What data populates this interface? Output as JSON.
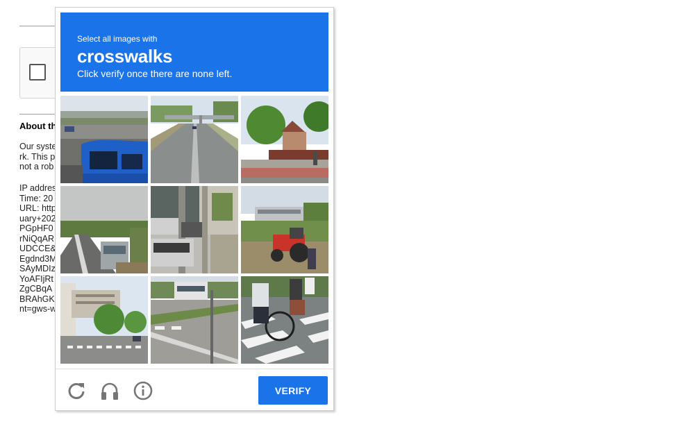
{
  "background_page": {
    "about_heading": "About th",
    "paragraph1": [
      "Our syste",
      "rk. This p",
      "not a rob"
    ],
    "paragraph2": [
      "IP addres",
      "Time: 20",
      "URL: http",
      "uary+202",
      "PGpHF0",
      "rNiQqAR",
      "UDCCE&",
      "Egdnd3M",
      "SAyMDIz",
      "YoAFIjRt",
      "ZgCBqA",
      "BRAhGK",
      "nt=gws-w"
    ]
  },
  "challenge": {
    "instruction_small": "Select all images with",
    "target_word": "crosswalks",
    "instruction_sub": "Click verify once there are none left.",
    "tiles": [
      {
        "icon": "highway-overpass-blue-car-image"
      },
      {
        "icon": "highway-overpass-road-image"
      },
      {
        "icon": "house-trees-sidewalk-image"
      },
      {
        "icon": "rural-road-bus-image"
      },
      {
        "icon": "parked-cars-building-image"
      },
      {
        "icon": "red-tractor-field-image"
      },
      {
        "icon": "city-street-crosswalk-image"
      },
      {
        "icon": "street-bus-crosswalk-image"
      },
      {
        "icon": "cyclist-pedestrian-crosswalk-image"
      }
    ],
    "footer": {
      "reload_icon": "reload-icon",
      "audio_icon": "headphones-icon",
      "info_icon": "info-icon",
      "verify_label": "Verify"
    },
    "colors": {
      "accent": "#1a73e8",
      "icon_gray": "#757575"
    }
  }
}
